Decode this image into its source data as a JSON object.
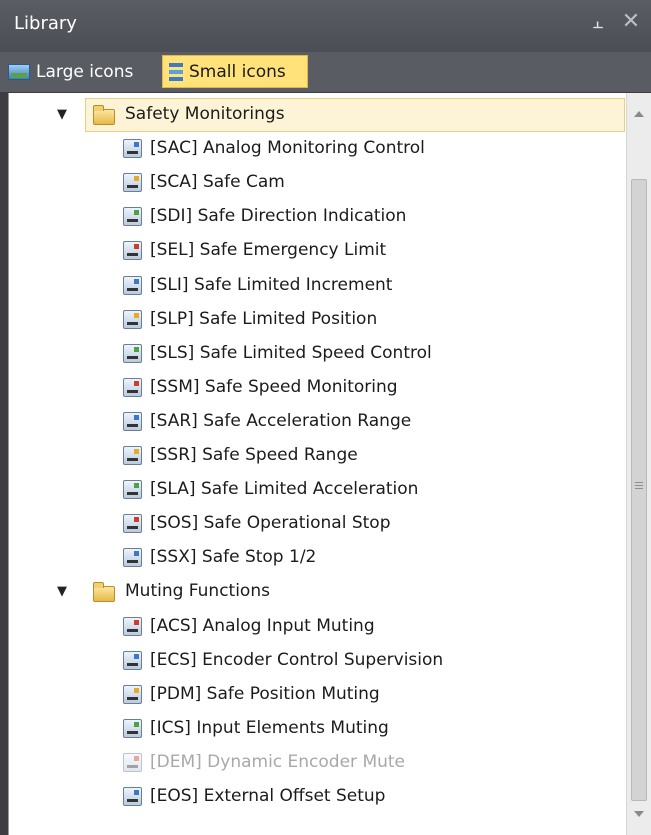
{
  "window": {
    "title": "Library",
    "pin_glyph": "⫠",
    "close_glyph": "✕"
  },
  "toolbar": {
    "large_icons_label": "Large icons",
    "small_icons_label": "Small icons",
    "active_view": "Small icons"
  },
  "tree": {
    "groups": [
      {
        "label": "Safety Monitorings",
        "expanded": true,
        "selected": true,
        "items": [
          {
            "label": "[SAC] Analog Monitoring Control",
            "icon": "analog-monitoring-icon"
          },
          {
            "label": "[SCA] Safe Cam",
            "icon": "safe-cam-icon"
          },
          {
            "label": "[SDI] Safe Direction Indication",
            "icon": "safe-direction-icon"
          },
          {
            "label": "[SEL] Safe Emergency Limit",
            "icon": "safe-emergency-limit-icon"
          },
          {
            "label": "[SLI] Safe Limited Increment",
            "icon": "safe-limited-increment-icon"
          },
          {
            "label": "[SLP] Safe Limited Position",
            "icon": "safe-limited-position-icon"
          },
          {
            "label": "[SLS] Safe Limited Speed Control",
            "icon": "safe-limited-speed-icon"
          },
          {
            "label": "[SSM] Safe Speed Monitoring",
            "icon": "safe-speed-monitoring-icon"
          },
          {
            "label": "[SAR] Safe Acceleration Range",
            "icon": "safe-acceleration-range-icon"
          },
          {
            "label": "[SSR] Safe Speed Range",
            "icon": "safe-speed-range-icon"
          },
          {
            "label": "[SLA] Safe Limited Acceleration",
            "icon": "safe-limited-acceleration-icon"
          },
          {
            "label": "[SOS] Safe Operational Stop",
            "icon": "safe-operational-stop-icon"
          },
          {
            "label": "[SSX] Safe Stop 1/2",
            "icon": "safe-stop-icon"
          }
        ]
      },
      {
        "label": "Muting Functions",
        "expanded": true,
        "selected": false,
        "items": [
          {
            "label": "[ACS] Analog Input Muting",
            "icon": "analog-input-muting-icon"
          },
          {
            "label": "[ECS] Encoder Control Supervision",
            "icon": "encoder-control-icon"
          },
          {
            "label": "[PDM] Safe Position Muting",
            "icon": "safe-position-muting-icon"
          },
          {
            "label": "[ICS] Input Elements Muting",
            "icon": "input-elements-muting-icon"
          },
          {
            "label": "[DEM] Dynamic Encoder Mute",
            "icon": "dynamic-encoder-mute-icon",
            "disabled": true
          },
          {
            "label": "[EOS] External Offset Setup",
            "icon": "external-offset-icon"
          }
        ]
      }
    ]
  }
}
